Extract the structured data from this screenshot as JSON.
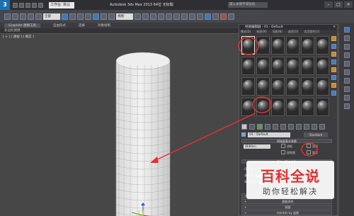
{
  "titlebar": {
    "app_title": "Autodesk 3ds Max 2013 64位 无标题",
    "workspace": "工作台: 默认",
    "search_placeholder": "键入关键字或短语",
    "minimize": "–",
    "maximize": "□",
    "close": "✕"
  },
  "toolbar": {
    "selection_filter": "全部",
    "view_dropdown": "视图"
  },
  "ribbon": {
    "tabs": [
      "Graphite 建模工具",
      "自由形式",
      "选择",
      "对象绘制"
    ],
    "sub_label": "多边形建模"
  },
  "viewport": {
    "label": "[ + ] [ 透视 ] [ 真实 ]"
  },
  "material_editor": {
    "title": "材质编辑器 - 01 - Default",
    "close": "✕",
    "menu": [
      "模式(D)",
      "材质(M)",
      "导航(N)",
      "选项(O)",
      "实用程序(U)"
    ],
    "slot_count": 24,
    "active_slot": 0,
    "material_name": "01 - Default",
    "material_type": "Standard",
    "rollouts": {
      "shader_basic": "明暗器基本参数",
      "blinn_basic": "Blinn 基本参数",
      "bottom": [
        "扩展参数",
        "超级采样",
        "贴图",
        "mental ray 连接"
      ]
    },
    "shading": "(B)Blinn",
    "checkboxes": [
      "线框",
      "双面",
      "面贴图",
      "面状"
    ],
    "params": [
      {
        "label": "环境光:",
        "color": "#2b2b2b"
      },
      {
        "label": "漫反射:",
        "color": "#e6e6e6"
      },
      {
        "label": "高光反射:",
        "color": "#e6e6e6"
      }
    ],
    "self_illum": "自发光",
    "specular_highlights": "反射高光"
  },
  "watermark": {
    "title": "百科全说",
    "subtitle": "助你轻松解决"
  },
  "colors": {
    "annotation_red": "#e8322e",
    "viewport_bg": "#474747",
    "cylinder": "#e9e9e9"
  }
}
